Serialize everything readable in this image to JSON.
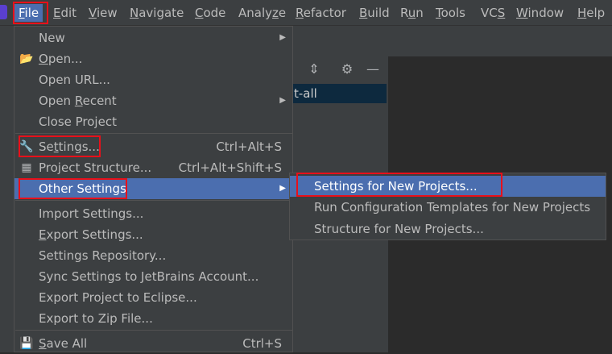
{
  "menubar": {
    "items": [
      {
        "label": "File",
        "mnemonic": "F",
        "rest": "ile"
      },
      {
        "label": "Edit",
        "mnemonic": "E",
        "rest": "dit"
      },
      {
        "label": "View",
        "mnemonic": "V",
        "rest": "iew"
      },
      {
        "label": "Navigate",
        "mnemonic": "N",
        "rest": "avigate"
      },
      {
        "label": "Code",
        "mnemonic": "C",
        "rest": "ode"
      },
      {
        "label": "Analyze",
        "pre": "Analy",
        "mnemonic": "z",
        "rest": "e"
      },
      {
        "label": "Refactor",
        "mnemonic": "R",
        "rest": "efactor"
      },
      {
        "label": "Build",
        "mnemonic": "B",
        "rest": "uild"
      },
      {
        "label": "Run",
        "pre": "R",
        "mnemonic": "u",
        "rest": "n"
      },
      {
        "label": "Tools",
        "mnemonic": "T",
        "rest": "ools"
      },
      {
        "label": "VCS",
        "pre": "VC",
        "mnemonic": "S",
        "rest": ""
      },
      {
        "label": "Window",
        "mnemonic": "W",
        "rest": "indow"
      },
      {
        "label": "Help",
        "mnemonic": "H",
        "rest": "elp"
      }
    ]
  },
  "background": {
    "project_row_text": "t-all"
  },
  "file_menu": {
    "new": "New",
    "open_pre": "",
    "open_mn": "O",
    "open_rest": "pen...",
    "open_url": "Open URL...",
    "open_recent_pre": "Open ",
    "open_recent_mn": "R",
    "open_recent_rest": "ecent",
    "close_project": "Close Project",
    "settings_pre": "Se",
    "settings_mn": "t",
    "settings_rest": "tings...",
    "settings_shortcut": "Ctrl+Alt+S",
    "project_structure": "Project Structure...",
    "project_structure_shortcut": "Ctrl+Alt+Shift+S",
    "other_settings": "Other Settings",
    "import_settings": "Import Settings...",
    "export_settings_mn": "E",
    "export_settings_rest": "xport Settings...",
    "settings_repository": "Settings Repository...",
    "sync_settings": "Sync Settings to JetBrains Account...",
    "export_eclipse": "Export Project to Eclipse...",
    "export_zip": "Export to Zip File...",
    "save_all_mn": "S",
    "save_all_rest": "ave All",
    "save_all_shortcut": "Ctrl+S"
  },
  "submenu": {
    "items": [
      "Settings for New Projects...",
      "Run Configuration Templates for New Projects",
      "Structure for New Projects..."
    ]
  },
  "colors": {
    "menu_bg": "#3c3f41",
    "selection": "#4b6eaf",
    "highlight_box": "#e8101a",
    "editor_bg": "#2b2b2b"
  }
}
